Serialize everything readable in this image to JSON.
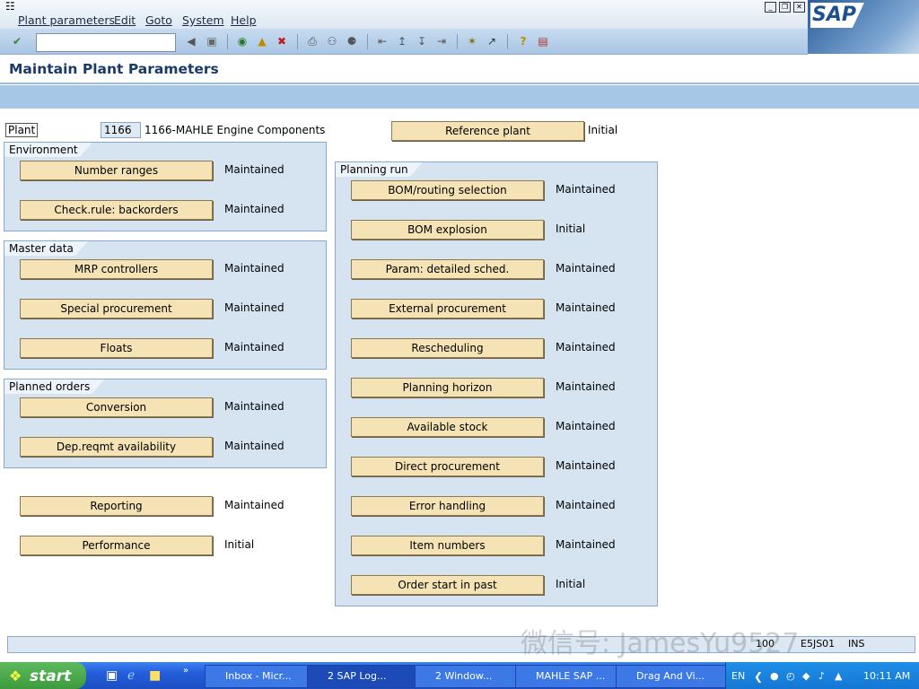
{
  "menu": {
    "items": [
      "Plant parameters",
      "Edit",
      "Goto",
      "System",
      "Help"
    ]
  },
  "toolbar": {
    "command_field": "",
    "icons": [
      "enter-icon",
      "back-icon",
      "save-icon",
      "green-back-icon",
      "exit-icon",
      "cancel-icon",
      "print-icon",
      "find-icon",
      "find-next-icon",
      "first-page-icon",
      "prev-page-icon",
      "next-page-icon",
      "last-page-icon",
      "create-session-icon",
      "shortcut-icon",
      "help-icon",
      "layout-icon"
    ]
  },
  "logo": "SAP",
  "title": "Maintain Plant Parameters",
  "plant": {
    "label": "Plant",
    "code": "1166",
    "description": "1166-MAHLE Engine Components"
  },
  "reference_plant": {
    "button": "Reference plant",
    "status": "Initial"
  },
  "environment": {
    "title": "Environment",
    "rows": [
      {
        "button": "Number ranges",
        "status": "Maintained"
      },
      {
        "button": "Check.rule: backorders",
        "status": "Maintained"
      }
    ]
  },
  "master_data": {
    "title": "Master data",
    "rows": [
      {
        "button": "MRP controllers",
        "status": "Maintained"
      },
      {
        "button": "Special procurement",
        "status": "Maintained"
      },
      {
        "button": "Floats",
        "status": "Maintained"
      }
    ]
  },
  "planned_orders": {
    "title": "Planned orders",
    "rows": [
      {
        "button": "Conversion",
        "status": "Maintained"
      },
      {
        "button": "Dep.reqmt availability",
        "status": "Maintained"
      }
    ]
  },
  "other": {
    "rows": [
      {
        "button": "Reporting",
        "status": "Maintained"
      },
      {
        "button": "Performance",
        "status": "Initial"
      }
    ]
  },
  "planning_run": {
    "title": "Planning run",
    "rows": [
      {
        "button": "BOM/routing selection",
        "status": "Maintained"
      },
      {
        "button": "BOM explosion",
        "status": "Initial"
      },
      {
        "button": "Param: detailed sched.",
        "status": "Maintained"
      },
      {
        "button": "External procurement",
        "status": "Maintained"
      },
      {
        "button": "Rescheduling",
        "status": "Maintained"
      },
      {
        "button": "Planning horizon",
        "status": "Maintained"
      },
      {
        "button": "Available stock",
        "status": "Maintained"
      },
      {
        "button": "Direct procurement",
        "status": "Maintained"
      },
      {
        "button": "Error handling",
        "status": "Maintained"
      },
      {
        "button": "Item numbers",
        "status": "Maintained"
      },
      {
        "button": "Order start in past",
        "status": "Initial"
      }
    ]
  },
  "statusbar": {
    "client": "100",
    "server": "E5JS01",
    "mode": "INS"
  },
  "taskbar": {
    "start": "start",
    "tasks": [
      "Inbox - Micr...",
      "2 SAP Log...",
      "2 Window...",
      "MAHLE SAP ...",
      "Drag And Vi..."
    ],
    "lang": "EN",
    "clock": "10:11 AM"
  },
  "watermark": "微信号: JamesYu9527",
  "colors": {
    "button_fill": "#f5e3b5",
    "group_fill": "#d6e4f2",
    "title_color": "#1b3a66",
    "taskbar_blue": "#245edb"
  }
}
